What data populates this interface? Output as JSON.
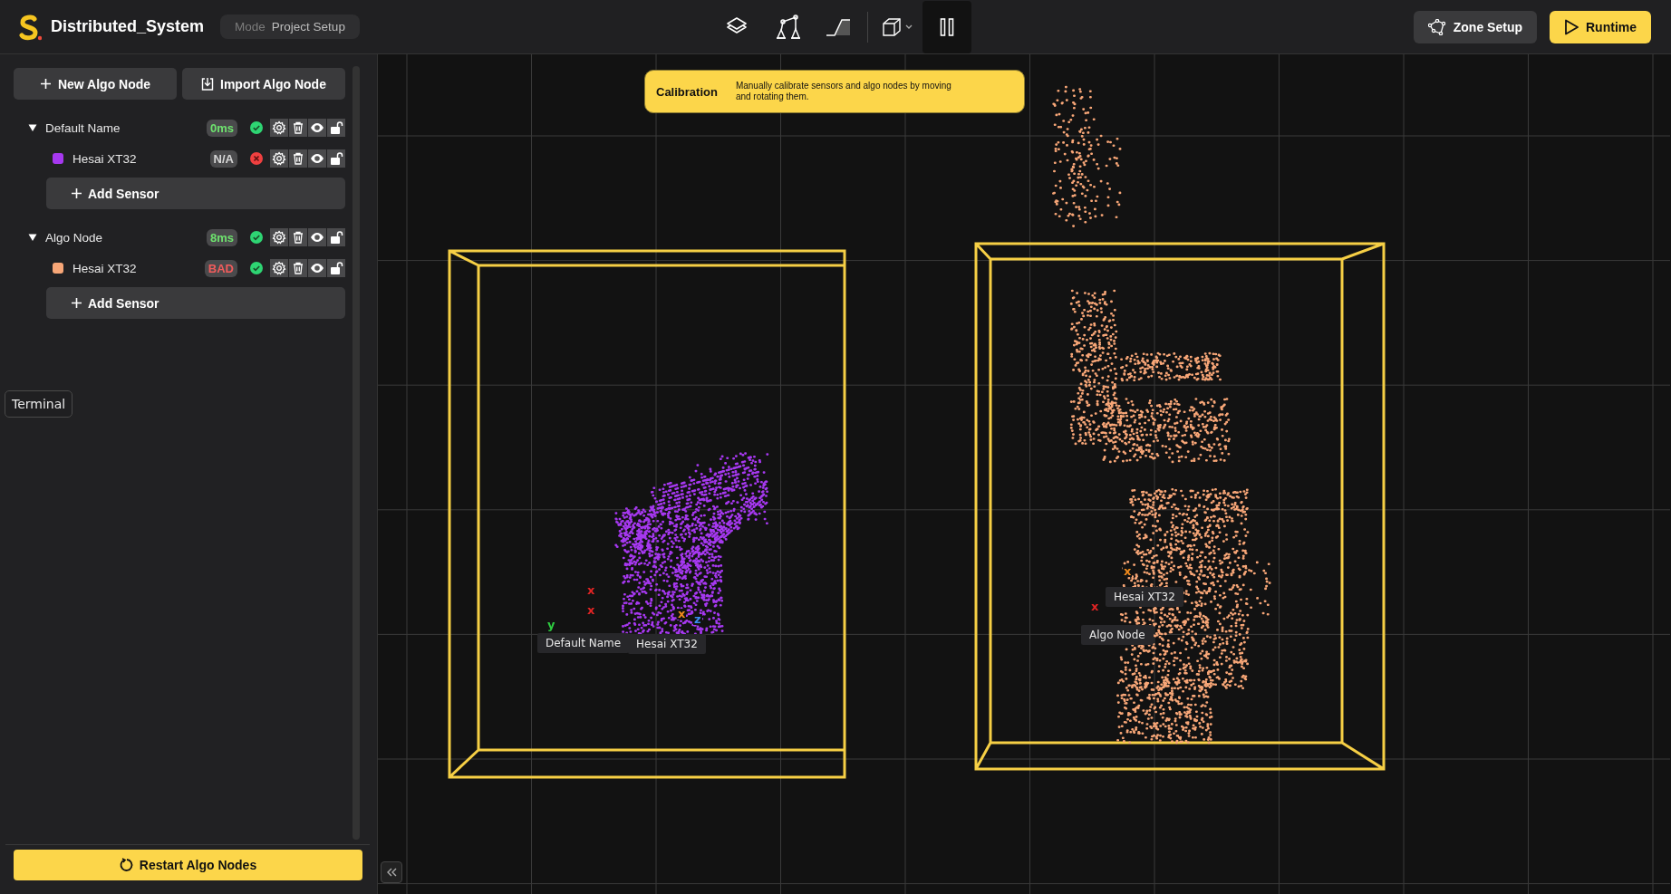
{
  "app": {
    "title": "Distributed_System",
    "mode_label": "Mode",
    "mode_value": "Project Setup"
  },
  "toolbar": {
    "tools": [
      {
        "kind": "layers",
        "selected": false
      },
      {
        "kind": "arm",
        "selected": false
      },
      {
        "kind": "ramp",
        "selected": false
      },
      {
        "kind": "view-cube",
        "selected": false
      },
      {
        "kind": "pause",
        "selected": true
      }
    ]
  },
  "header_buttons": [
    {
      "label": "Zone Setup",
      "kind": "secondary"
    },
    {
      "label": "Runtime",
      "kind": "primary"
    }
  ],
  "sidebar": {
    "actions": [
      {
        "label": "New Algo Node",
        "kind": "plus"
      },
      {
        "label": "Import Algo Node",
        "kind": "import"
      }
    ],
    "nodes": [
      {
        "name": "Default Name",
        "expanded": true,
        "latency": {
          "text": "0ms",
          "color": "#6ee36e"
        },
        "ok": true,
        "add_label": "Add Sensor",
        "children": [
          {
            "name": "Hesai XT32",
            "color": "#a638f0",
            "latency": {
              "text": "N/A",
              "color": "#d6d6d6"
            },
            "ok": false
          }
        ]
      },
      {
        "name": "Algo Node",
        "expanded": true,
        "latency": {
          "text": "8ms",
          "color": "#6ee36e"
        },
        "ok": true,
        "add_label": "Add Sensor",
        "children": [
          {
            "name": "Hesai XT32",
            "color": "#f7a677",
            "latency": {
              "text": "BAD",
              "color": "#f25c5c"
            },
            "ok": true
          }
        ]
      }
    ],
    "restart_button": "Restart Algo Nodes"
  },
  "tooltip": "Terminal",
  "banner": {
    "title": "Calibration",
    "text": "Manually calibrate sensors and algo nodes by moving and rotating them."
  },
  "viewport": {
    "labels": [
      {
        "text": "Default Name"
      },
      {
        "text": "Hesai XT32"
      },
      {
        "text": "Hesai XT32"
      },
      {
        "text": "Algo Node"
      }
    ],
    "axis_marks": [
      {
        "text": "x",
        "color": "#e02424"
      },
      {
        "text": "x",
        "color": "#e02424"
      },
      {
        "text": "y",
        "color": "#2ecc40"
      },
      {
        "text": "x",
        "color": "#f08a1c"
      },
      {
        "text": "z",
        "color": "#3b8cf0"
      },
      {
        "text": "x",
        "color": "#f08a1c"
      },
      {
        "text": "x",
        "color": "#e02424"
      }
    ]
  }
}
